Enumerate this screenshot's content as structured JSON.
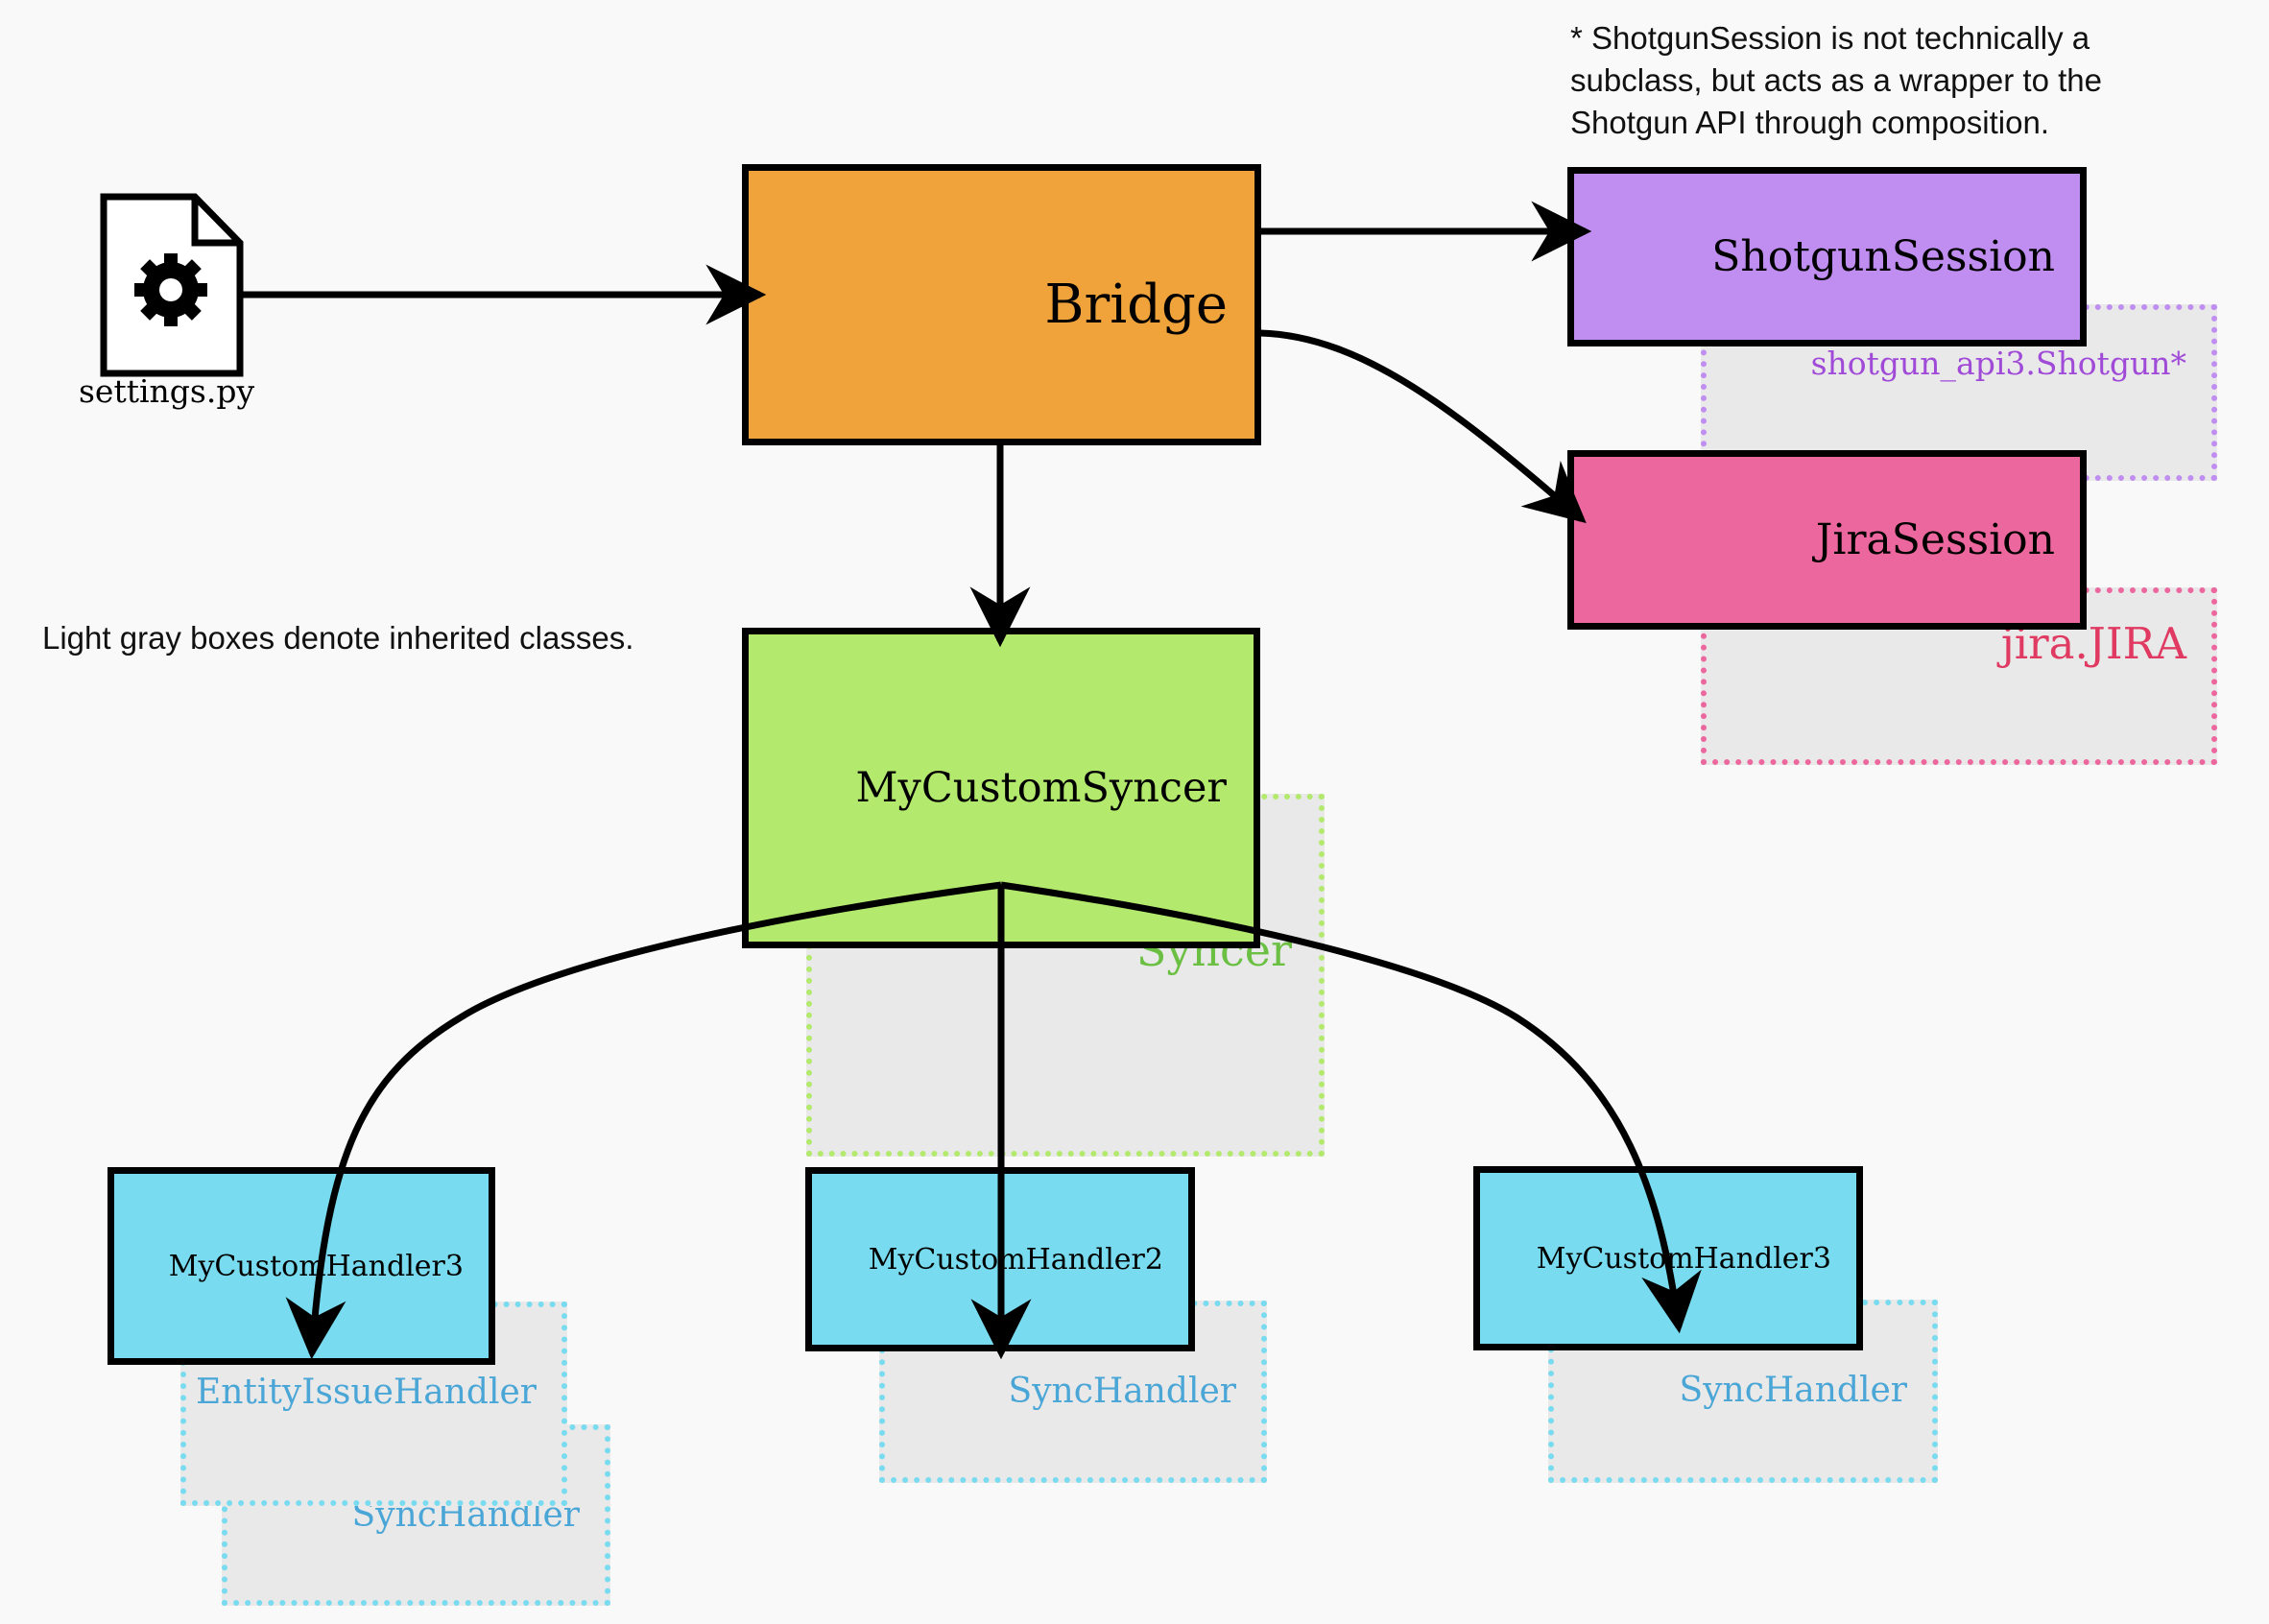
{
  "notes": {
    "composition_note": [
      "* ShotgunSession is not technically a",
      "subclass, but acts as a wrapper to the",
      "Shotgun API through composition."
    ],
    "legend": "Light gray boxes denote inherited classes."
  },
  "settings_file": {
    "label": "settings.py",
    "icon": "file-gear-icon"
  },
  "nodes": {
    "bridge": {
      "label": "Bridge",
      "color": "#F0A33A"
    },
    "shotgun_session": {
      "label": "ShotgunSession",
      "color": "#C08EF0",
      "parent": "shotgun_api3.Shotgun*",
      "parent_color": "#A04AD8",
      "parent_border": "#C08EF0"
    },
    "jira_session": {
      "label": "JiraSession",
      "color": "#EC679D",
      "parent": "jira.JIRA",
      "parent_color": "#E03A62",
      "parent_border": "#EC679D"
    },
    "syncer": {
      "label": "MyCustomSyncer",
      "color": "#B3EA6E",
      "parent": "Syncer",
      "parent_color": "#6BC043",
      "parent_border": "#B3EA6E"
    },
    "handler_left": {
      "label": "MyCustomHandler3",
      "color": "#78DBEF",
      "parents": [
        "EntityIssueHandler",
        "SyncHandler"
      ],
      "parent_color": "#4AA6D6",
      "parent_border": "#78DBEF"
    },
    "handler_middle": {
      "label": "MyCustomHandler2",
      "color": "#78DBEF",
      "parents": [
        "SyncHandler"
      ],
      "parent_color": "#4AA6D6",
      "parent_border": "#78DBEF"
    },
    "handler_right": {
      "label": "MyCustomHandler3",
      "color": "#78DBEF",
      "parents": [
        "SyncHandler"
      ],
      "parent_color": "#4AA6D6",
      "parent_border": "#78DBEF"
    }
  },
  "edges": [
    {
      "from": "settings.py",
      "to": "Bridge"
    },
    {
      "from": "Bridge",
      "to": "ShotgunSession"
    },
    {
      "from": "Bridge",
      "to": "JiraSession"
    },
    {
      "from": "Bridge",
      "to": "MyCustomSyncer"
    },
    {
      "from": "MyCustomSyncer",
      "to": "MyCustomHandler3 (left)"
    },
    {
      "from": "MyCustomSyncer",
      "to": "MyCustomHandler2"
    },
    {
      "from": "MyCustomSyncer",
      "to": "MyCustomHandler3 (right)"
    }
  ]
}
